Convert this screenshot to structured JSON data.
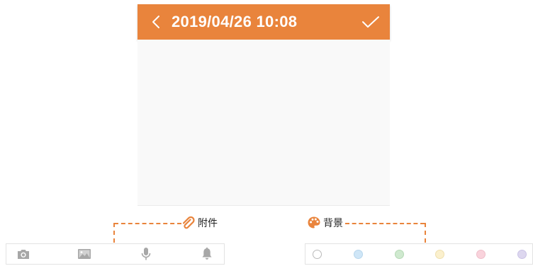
{
  "header": {
    "title": "2019/04/26 10:08",
    "back_icon": "chevron-left-icon",
    "confirm_icon": "checkmark-icon"
  },
  "colors": {
    "accent": "#e9843c",
    "canvas": "#f9f9f9",
    "icon_gray": "#a7a7a7"
  },
  "callouts": {
    "attach": {
      "label": "附件",
      "icon": "paperclip-icon"
    },
    "background": {
      "label": "背景",
      "icon": "palette-icon"
    }
  },
  "attach_bar": {
    "items": [
      {
        "icon": "camera-icon"
      },
      {
        "icon": "image-icon"
      },
      {
        "icon": "microphone-icon"
      },
      {
        "icon": "bell-icon"
      }
    ]
  },
  "background_bar": {
    "swatches": [
      {
        "name": "white",
        "color": "#ffffff",
        "border": "#b9b9b9"
      },
      {
        "name": "blue",
        "color": "#cfe6f7",
        "border": "#b7d6ec"
      },
      {
        "name": "green",
        "color": "#cfe9cf",
        "border": "#b5d9b5"
      },
      {
        "name": "yellow",
        "color": "#fbf0cd",
        "border": "#efdfae"
      },
      {
        "name": "pink",
        "color": "#f9d3dc",
        "border": "#efbfca"
      },
      {
        "name": "lavender",
        "color": "#ddd7ef",
        "border": "#cbc3e6"
      }
    ]
  }
}
